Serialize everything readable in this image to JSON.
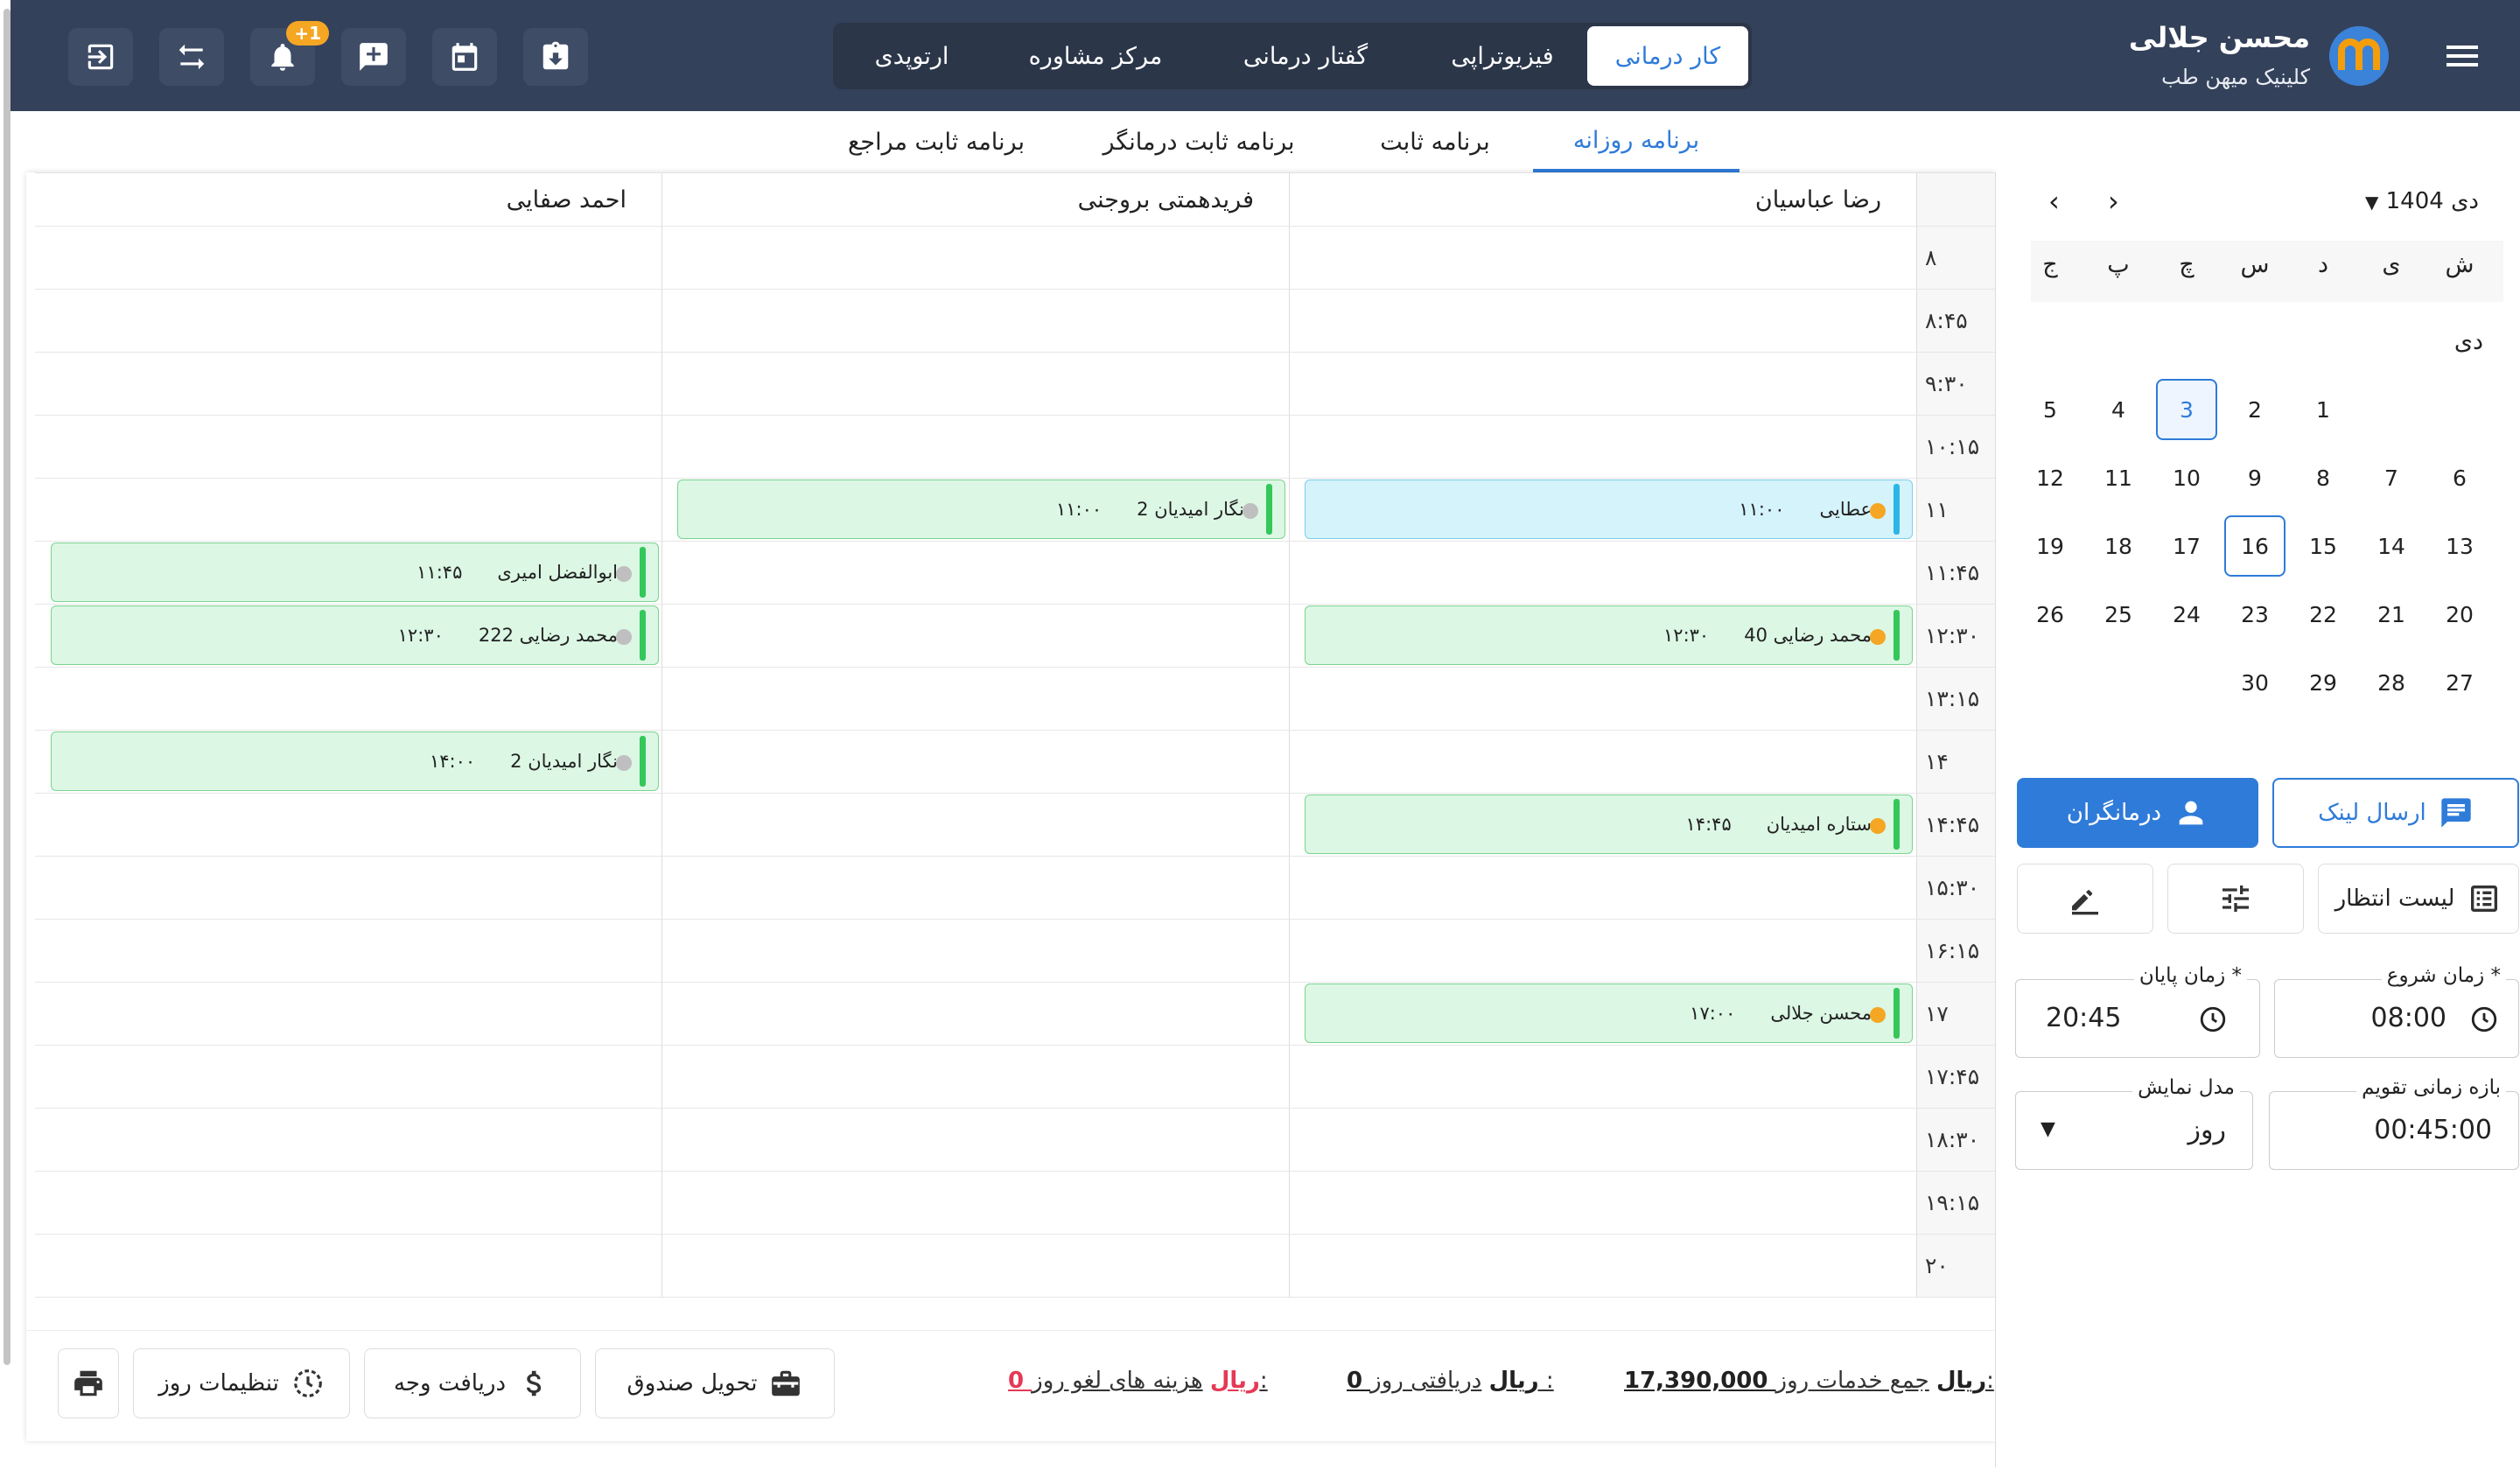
{
  "header": {
    "user_name": "محسن جلالی",
    "clinic_name": "کلینیک میهن طب",
    "notification_badge": "+1",
    "clinic_tabs": [
      "کار درمانی",
      "فیزیوتراپی",
      "گفتار درمانی",
      "مرکز مشاوره",
      "ارتوپدی"
    ],
    "active_tab": "کار درمانی"
  },
  "view_tabs": [
    "برنامه روزانه",
    "برنامه ثابت",
    "برنامه ثابت درمانگر",
    "برنامه ثابت مراجع"
  ],
  "schedule": {
    "therapists": [
      "رضا عباسیان",
      "فریدهمتی بروجنی",
      "احمد صفایی"
    ],
    "times": [
      "۸",
      "۸:۴۵",
      "۹:۳۰",
      "۱۰:۱۵",
      "۱۱",
      "۱۱:۴۵",
      "۱۲:۳۰",
      "۱۳:۱۵",
      "۱۴",
      "۱۴:۴۵",
      "۱۵:۳۰",
      "۱۶:۱۵",
      "۱۷",
      "۱۷:۴۵",
      "۱۸:۳۰",
      "۱۹:۱۵",
      "۲۰"
    ],
    "appointments": [
      {
        "therapist": 0,
        "slot": 4,
        "name": "عطایی",
        "time": "۱۱:۰۰",
        "color": "blue",
        "dot": "orange"
      },
      {
        "therapist": 1,
        "slot": 4,
        "name": "نگار امیدیان 2",
        "time": "۱۱:۰۰",
        "color": "green",
        "dot": "gray"
      },
      {
        "therapist": 2,
        "slot": 5,
        "name": "ابوالفضل امیری",
        "time": "۱۱:۴۵",
        "color": "green",
        "dot": "gray"
      },
      {
        "therapist": 0,
        "slot": 6,
        "name": "محمد رضایی 40",
        "time": "۱۲:۳۰",
        "color": "green",
        "dot": "orange"
      },
      {
        "therapist": 2,
        "slot": 6,
        "name": "محمد رضایی 222",
        "time": "۱۲:۳۰",
        "color": "green",
        "dot": "gray"
      },
      {
        "therapist": 2,
        "slot": 8,
        "name": "نگار امیدیان 2",
        "time": "۱۴:۰۰",
        "color": "green",
        "dot": "gray"
      },
      {
        "therapist": 0,
        "slot": 9,
        "name": "ستاره امیدیان",
        "time": "۱۴:۴۵",
        "color": "green",
        "dot": "orange"
      },
      {
        "therapist": 0,
        "slot": 12,
        "name": "محسن جلالی",
        "time": "۱۷:۰۰",
        "color": "green",
        "dot": "orange"
      }
    ]
  },
  "footer": {
    "total_services_label": "جمع خدمات روز:",
    "total_services_value": "17,390,000 ریال",
    "daily_received_label": "دریافتی روز :",
    "daily_received_value": "0 ریال",
    "cancel_fees_label": "هزینه های لغو روز:",
    "cancel_fees_value": "0 ریال",
    "cash_handover": "تحویل صندوق",
    "receive_payment": "دریافت وجه",
    "day_settings": "تنظیمات روز"
  },
  "calendar": {
    "month_title": "1404 دی",
    "weekdays": [
      "ش",
      "ی",
      "د",
      "س",
      "چ",
      "پ",
      "ج"
    ],
    "month_label": "دی",
    "weeks": [
      [
        "",
        "",
        "1",
        "2",
        "3",
        "4",
        "5"
      ],
      [
        "6",
        "7",
        "8",
        "9",
        "10",
        "11",
        "12"
      ],
      [
        "13",
        "14",
        "15",
        "16",
        "17",
        "18",
        "19"
      ],
      [
        "20",
        "21",
        "22",
        "23",
        "24",
        "25",
        "26"
      ],
      [
        "27",
        "28",
        "29",
        "30",
        "",
        "",
        ""
      ]
    ],
    "selected_day": "3",
    "today_day": "16"
  },
  "sidebar": {
    "send_link": "ارسال لینک",
    "therapists": "درمانگران",
    "waiting_list": "لیست انتظار",
    "start_time_label": "زمان شروع *",
    "start_time_value": "08:00",
    "end_time_label": "زمان پایان *",
    "end_time_value": "20:45",
    "interval_label": "بازه زمانی تقویم",
    "interval_value": "00:45:00",
    "view_mode_label": "مدل نمایش",
    "view_mode_value": "روز"
  },
  "colors": {
    "header_bg": "#34415a",
    "accent": "#2f7bd9",
    "appt_green": "#dcf7e4",
    "appt_blue": "#d5f3fb",
    "badge": "#f5a623"
  }
}
